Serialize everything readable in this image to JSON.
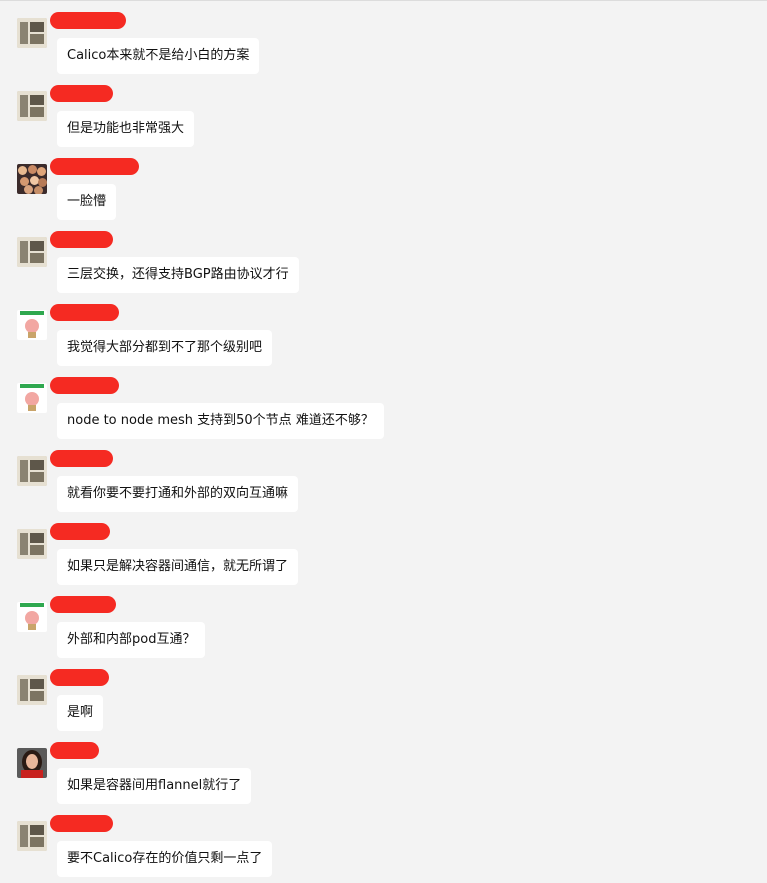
{
  "messages": [
    {
      "avatar": "calligraphy-avatar",
      "text": "Calico本来就不是给小白的方案"
    },
    {
      "avatar": "calligraphy-avatar",
      "text": "但是功能也非常强大"
    },
    {
      "avatar": "group-photo-avatar",
      "text": "一脸懵"
    },
    {
      "avatar": "calligraphy-avatar",
      "text": "三层交换，还得支持BGP路由协议才行"
    },
    {
      "avatar": "cartoon-avatar",
      "text": "我觉得大部分都到不了那个级别吧"
    },
    {
      "avatar": "cartoon-avatar",
      "text": "node to node mesh 支持到50个节点 难道还不够？"
    },
    {
      "avatar": "calligraphy-avatar",
      "text": "就看你要不要打通和外部的双向互通嘛"
    },
    {
      "avatar": "calligraphy-avatar",
      "text": "如果只是解决容器间通信，就无所谓了"
    },
    {
      "avatar": "cartoon-avatar",
      "text": "外部和内部pod互通？"
    },
    {
      "avatar": "calligraphy-avatar",
      "text": "是啊"
    },
    {
      "avatar": "portrait-avatar",
      "text": "如果是容器间用flannel就行了"
    },
    {
      "avatar": "calligraphy-avatar",
      "text": "要不Calico存在的价值只剩一点了"
    }
  ],
  "colors": {
    "background": "#f3f3f3",
    "bubble": "#ffffff",
    "redaction": "#f52a22"
  }
}
